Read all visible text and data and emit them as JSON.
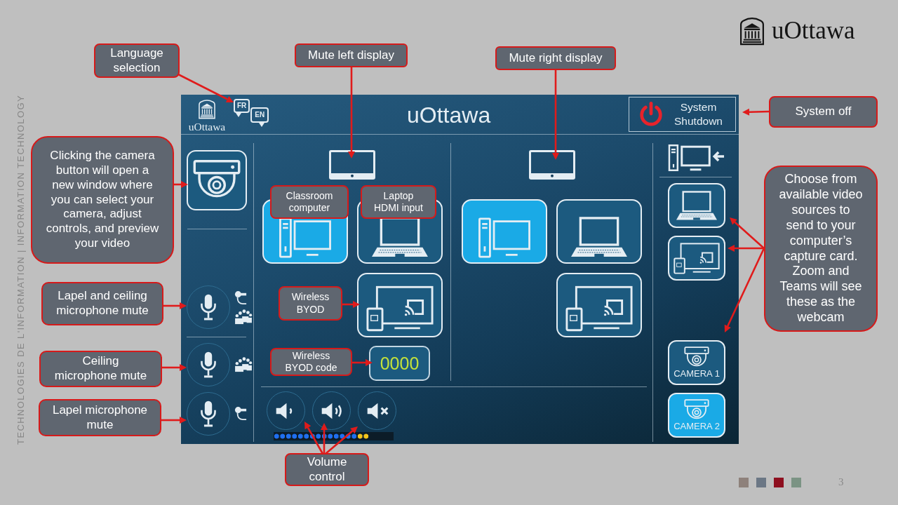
{
  "side_label": "TECHNOLOGIES DE L'INFORMATION | INFORMATION TECHNOLOGY",
  "brand": {
    "text": "uOttawa"
  },
  "panel": {
    "header": {
      "logo_text": "uOttawa",
      "languages": [
        "FR",
        "EN"
      ],
      "title": "uOttawa",
      "shutdown_button": "System Shutdown"
    },
    "microphones": [
      {
        "kind": "both"
      },
      {
        "kind": "ceiling"
      },
      {
        "kind": "lapel"
      }
    ],
    "displays": [
      {
        "sources": [
          {
            "kind": "computer",
            "selected": true
          },
          {
            "kind": "laptop",
            "selected": false
          },
          {
            "kind": "wireless",
            "selected": false
          }
        ],
        "byod_code": "0000"
      },
      {
        "sources": [
          {
            "kind": "computer",
            "selected": true
          },
          {
            "kind": "laptop",
            "selected": false
          },
          {
            "kind": "wireless",
            "selected": false
          }
        ]
      }
    ],
    "volume": {
      "buttons": [
        {
          "kind": "down"
        },
        {
          "kind": "up"
        },
        {
          "kind": "mute"
        }
      ],
      "level": 0.8
    },
    "capture_sources": [
      {
        "kind": "laptop",
        "selected": false
      },
      {
        "kind": "wireless",
        "selected": false
      },
      {
        "kind": "camera",
        "label": "CAMERA 1",
        "selected": false
      },
      {
        "kind": "camera",
        "label": "CAMERA 2",
        "selected": true
      }
    ]
  },
  "callouts": [
    {
      "text": "Language selection"
    },
    {
      "text": "Mute left display"
    },
    {
      "text": "Mute right display"
    },
    {
      "text": "System off"
    },
    {
      "text": "Clicking the camera button will open a new window where you can select your camera, adjust controls, and preview your video"
    },
    {
      "text": "Lapel and ceiling microphone mute"
    },
    {
      "text": "Ceiling microphone mute"
    },
    {
      "text": "Lapel microphone mute"
    },
    {
      "text": "Classroom computer"
    },
    {
      "text": "Laptop HDMI input"
    },
    {
      "text": "Wireless BYOD"
    },
    {
      "text": "Wireless BYOD code"
    },
    {
      "text": "Choose from available video sources to send to your computer’s capture card. Zoom and Teams will see these as the webcam"
    },
    {
      "text": "Volume control"
    }
  ],
  "footer": {
    "swatches": [
      {
        "color": "#8e817b"
      },
      {
        "color": "#6b7785"
      },
      {
        "color": "#8e0f1f"
      },
      {
        "color": "#7b9384"
      }
    ],
    "page_number": "3"
  }
}
